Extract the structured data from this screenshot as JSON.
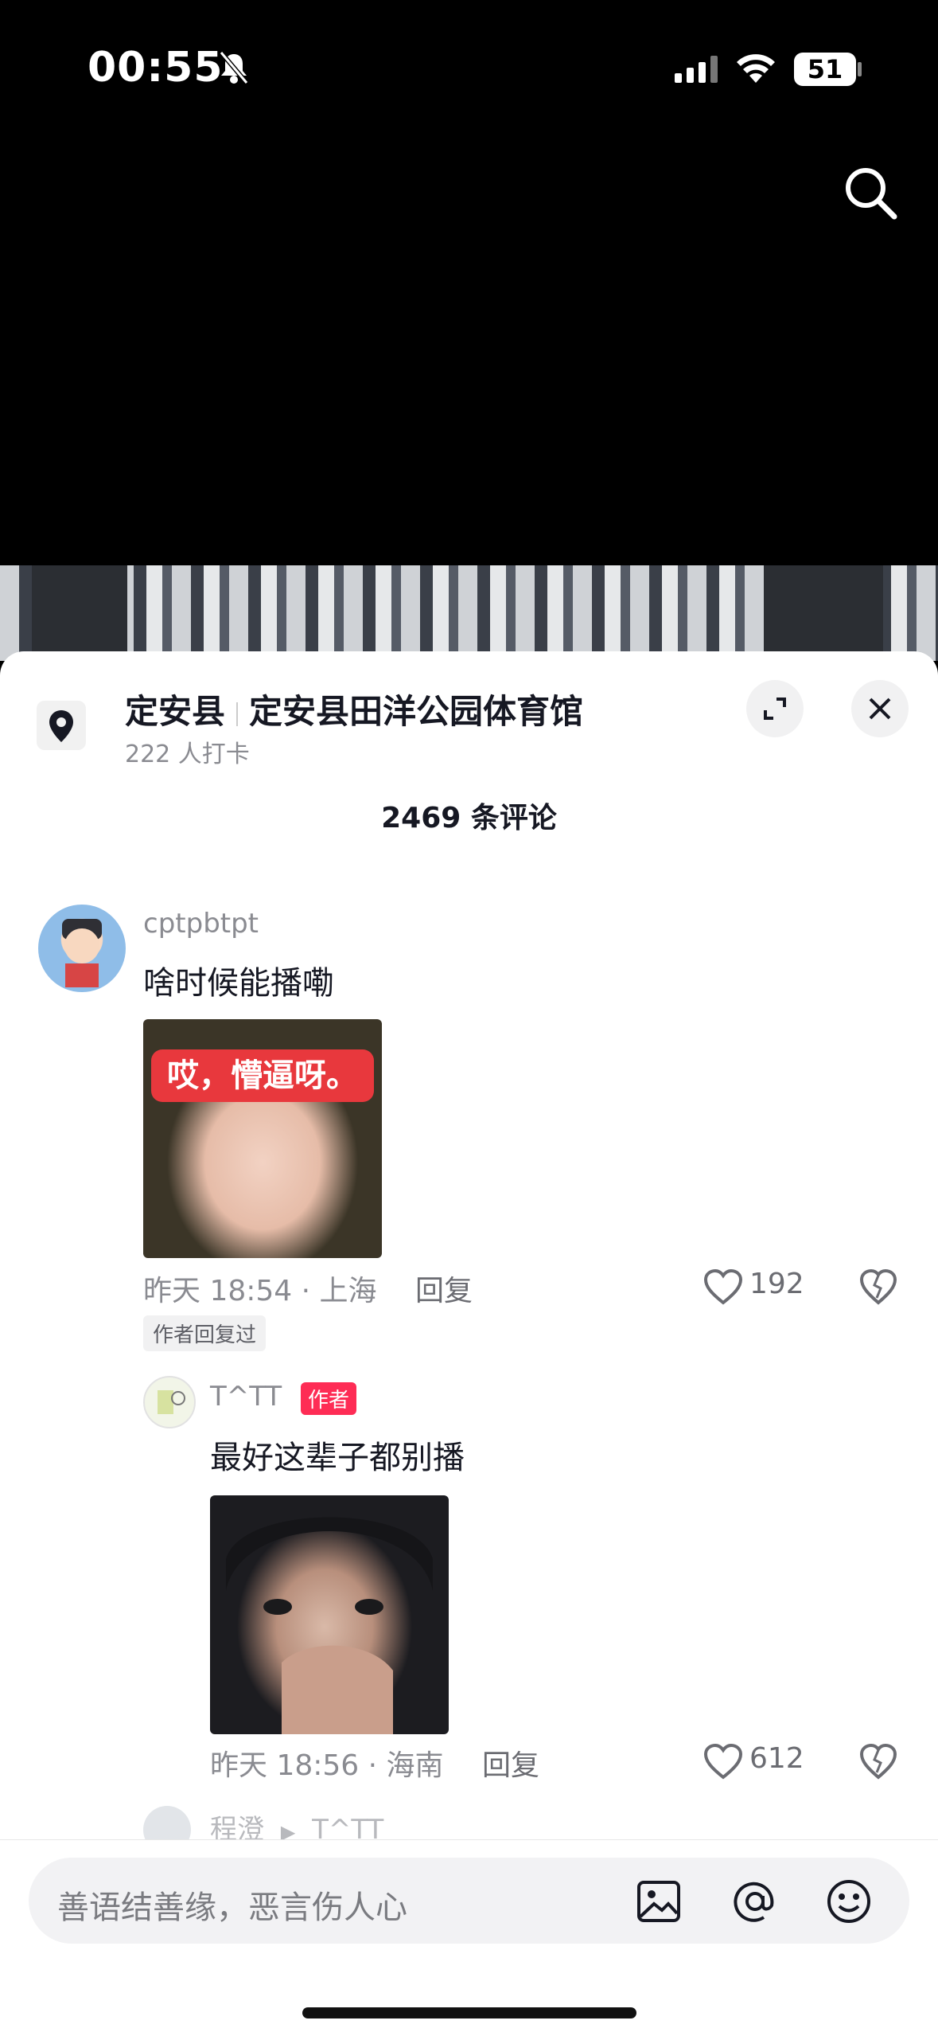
{
  "status_bar": {
    "time": "00:55",
    "battery": "51"
  },
  "location": {
    "county": "定安县",
    "place": "定安县田洋公园体育馆",
    "checkins": "222 人打卡"
  },
  "comments_header": "2469 条评论",
  "comments": [
    {
      "username": "cptpbtpt",
      "text": "啥时候能播嘞",
      "image_caption": "哎，懵逼呀。",
      "meta": "昨天 18:54 · 上海",
      "reply_label": "回复",
      "likes": "192",
      "tag": "作者回复过"
    },
    {
      "username": "T^TT",
      "badge": "作者",
      "text": "最好这辈子都别播",
      "meta": "昨天 18:56 · 海南",
      "reply_label": "回复",
      "likes": "612"
    }
  ],
  "next_reply_preview": {
    "from": "程澄",
    "to": "T^TT"
  },
  "input": {
    "placeholder": "善语结善缘，恶言伤人心"
  },
  "icons": [
    "bell-slash-icon",
    "signal-icon",
    "wifi-icon",
    "search-icon",
    "location-pin-icon",
    "expand-icon",
    "close-icon",
    "heart-icon",
    "dislike-icon",
    "image-icon",
    "at-icon",
    "emoji-icon"
  ]
}
